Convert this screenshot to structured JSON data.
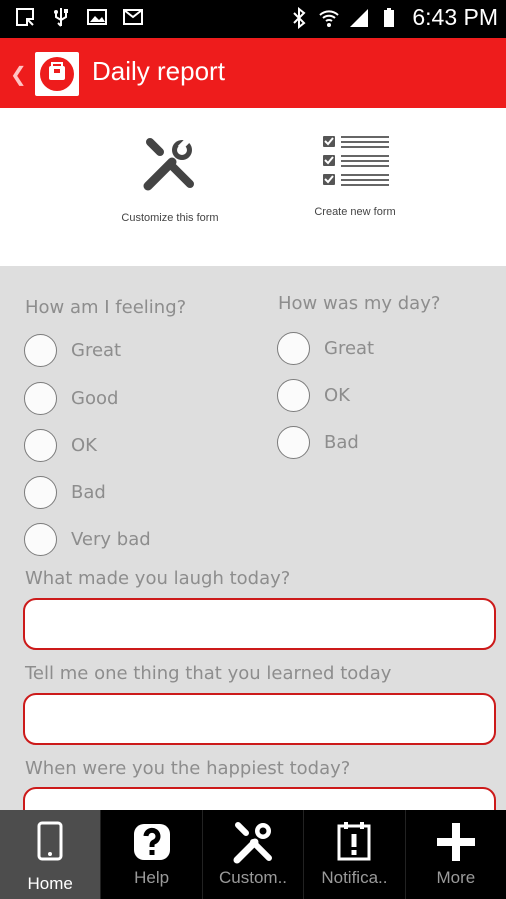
{
  "status_bar": {
    "time": "6:43 PM",
    "left_icons": [
      "screenshot-icon",
      "usb-icon",
      "image-icon",
      "email-icon"
    ],
    "right_icons": [
      "bluetooth-icon",
      "wifi-icon",
      "signal-icon",
      "battery-icon"
    ]
  },
  "app_bar": {
    "title": "Daily report",
    "color": "#ee1c1c"
  },
  "actions": {
    "customize_label": "Customize this form",
    "create_label": "Create new form"
  },
  "form": {
    "q_feeling": "How am I feeling?",
    "feeling_options": [
      "Great",
      "Good",
      "OK",
      "Bad",
      "Very bad"
    ],
    "q_day": "How was my day?",
    "day_options": [
      "Great",
      "OK",
      "Bad"
    ],
    "q_laugh": "What made you laugh today?",
    "laugh_value": "",
    "q_learned": "Tell me one thing that you learned today",
    "learned_value": "",
    "q_happiest": "When were you the happiest today?",
    "happiest_value": ""
  },
  "bottom_nav": {
    "items": [
      {
        "label": "Home",
        "icon": "phone-icon",
        "active": true
      },
      {
        "label": "Help",
        "icon": "help-icon",
        "active": false
      },
      {
        "label": "Custom..",
        "icon": "tools-icon",
        "active": false
      },
      {
        "label": "Notifica..",
        "icon": "notification-icon",
        "active": false
      },
      {
        "label": "More",
        "icon": "plus-icon",
        "active": false
      }
    ]
  }
}
